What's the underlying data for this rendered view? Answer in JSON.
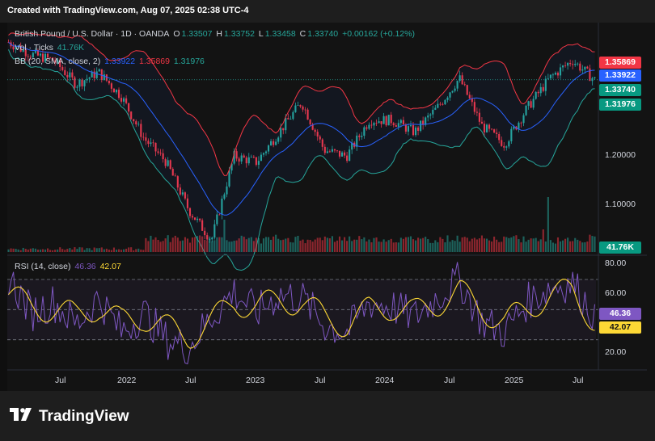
{
  "header": {
    "created": "Created with TradingView.com, Aug 07, 2025 02:38 UTC-4"
  },
  "legend": {
    "symbol": "British Pound / U.S. Dollar · 1D · OANDA",
    "o_label": "O",
    "o_value": "1.33507",
    "h_label": "H",
    "h_value": "1.33752",
    "l_label": "L",
    "l_value": "1.33458",
    "c_label": "C",
    "c_value": "1.33740",
    "change": "+0.00162 (+0.12%)",
    "vol_label": "Vol · Ticks",
    "vol_value": "41.76K",
    "bb_label": "BB (20, SMA, close, 2)",
    "bb_basis": "1.33922",
    "bb_upper": "1.35869",
    "bb_lower": "1.31976",
    "rsi_label": "RSI (14, close)",
    "rsi_value": "46.36",
    "rsi_ma_value": "42.07"
  },
  "price_tags": {
    "upper": "1.35869",
    "basis": "1.33922",
    "close": "1.33740",
    "lower": "1.31976",
    "volume": "41.76K",
    "rsi": "46.36",
    "rsi_ma": "42.07"
  },
  "colors": {
    "background": "#131313",
    "up": "#26a69a",
    "down": "#f23645",
    "bb_upper": "#f23645",
    "bb_basis": "#2962ff",
    "bb_lower": "#26a69a",
    "rsi": "#7e57c2",
    "rsi_ma": "#fdd835"
  },
  "footer": {
    "brand": "TradingView",
    "logo_icon": "tradingview-logo-icon"
  },
  "chart_data": [
    {
      "type": "line",
      "name": "price",
      "x": [
        "2021-05",
        "2021-07",
        "2021-09",
        "2021-11",
        "2022-01",
        "2022-03",
        "2022-05",
        "2022-07",
        "2022-09",
        "2022-10",
        "2022-12",
        "2023-02",
        "2023-04",
        "2023-07",
        "2023-09",
        "2023-10",
        "2024-01",
        "2024-03",
        "2024-05",
        "2024-07",
        "2024-09",
        "2024-11",
        "2025-01",
        "2025-03",
        "2025-05",
        "2025-07",
        "2025-08"
      ],
      "series": [
        {
          "values": [
            1.4,
            1.38,
            1.37,
            1.33,
            1.35,
            1.31,
            1.24,
            1.2,
            1.12,
            1.07,
            1.21,
            1.2,
            1.25,
            1.3,
            1.22,
            1.21,
            1.27,
            1.27,
            1.25,
            1.29,
            1.34,
            1.26,
            1.23,
            1.29,
            1.34,
            1.37,
            1.337
          ]
        }
      ],
      "y_ticks": [
        "1.10000",
        "1.20000"
      ],
      "x_ticks": [
        "Jul",
        "2022",
        "Jul",
        "2023",
        "Jul",
        "2024",
        "Jul",
        "2025",
        "Jul"
      ],
      "ylim": [
        1.05,
        1.43
      ]
    },
    {
      "type": "bar",
      "name": "volume",
      "last_value": "41.76K"
    },
    {
      "type": "line",
      "name": "RSI",
      "series": [
        {
          "values": [
            72,
            48,
            55,
            40,
            58,
            35,
            48,
            30,
            25,
            45,
            62,
            48,
            60,
            58,
            40,
            35,
            55,
            52,
            45,
            58,
            70,
            42,
            35,
            55,
            65,
            68,
            46.36
          ]
        },
        {
          "values": [
            60,
            52,
            50,
            46,
            52,
            42,
            45,
            38,
            32,
            42,
            55,
            52,
            56,
            55,
            45,
            40,
            50,
            52,
            48,
            54,
            62,
            50,
            42,
            50,
            60,
            62,
            42.07
          ]
        }
      ],
      "y_ticks": [
        "80.00",
        "60.00",
        "20.00"
      ],
      "levels": [
        70,
        50,
        30
      ],
      "ylim": [
        10,
        85
      ]
    }
  ]
}
